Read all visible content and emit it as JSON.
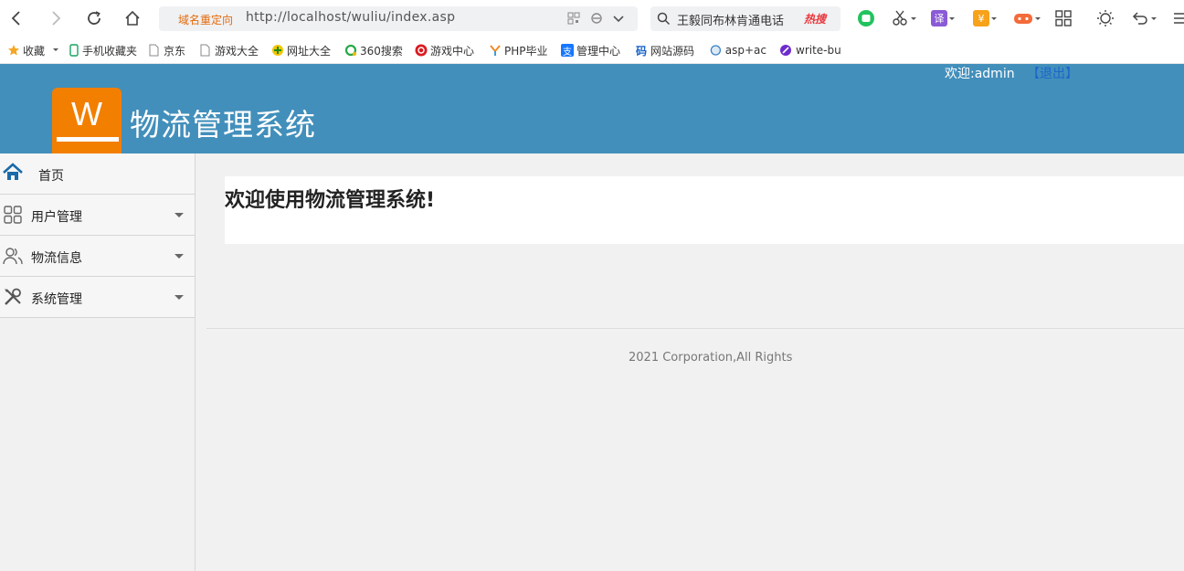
{
  "browser": {
    "address": {
      "redirect_label": "域名重定向",
      "url": "http://localhost/wuliu/index.asp"
    },
    "search": {
      "text": "王毅同布林肯通电话",
      "hot_label": "热搜"
    },
    "tool_labels": {
      "translate": "译",
      "coupon": "¥"
    },
    "bookmarks": [
      {
        "label": "收藏",
        "icon": "star-icon"
      },
      {
        "label": "手机收藏夹",
        "icon": "phone-icon"
      },
      {
        "label": "京东",
        "icon": "page-icon"
      },
      {
        "label": "游戏大全",
        "icon": "page-icon"
      },
      {
        "label": "网址大全",
        "icon": "globe-icon"
      },
      {
        "label": "360搜索",
        "icon": "search360-icon"
      },
      {
        "label": "游戏中心",
        "icon": "game-icon"
      },
      {
        "label": "PHP毕业",
        "icon": "php-icon"
      },
      {
        "label": "管理中心",
        "icon": "admin-icon"
      },
      {
        "label": "网站源码",
        "icon": "code-icon"
      },
      {
        "label": "asp+ac",
        "icon": "asp-icon"
      },
      {
        "label": "write-bu",
        "icon": "write-icon"
      }
    ],
    "bookmark_glyphs": {
      "admin": "支",
      "code": "码"
    }
  },
  "header": {
    "logo_letter": "W",
    "title": "物流管理系统",
    "welcome_label": "欢迎:",
    "username": "admin",
    "logout_label": "【退出】"
  },
  "sidebar": {
    "items": [
      {
        "label": "首页",
        "icon": "home-icon"
      },
      {
        "label": "用户管理",
        "icon": "grid-icon"
      },
      {
        "label": "物流信息",
        "icon": "users-icon"
      },
      {
        "label": "系统管理",
        "icon": "tools-icon"
      }
    ]
  },
  "main": {
    "welcome_heading": "欢迎使用物流管理系统!",
    "footer": "2021 Corporation,All Rights"
  },
  "colors": {
    "header_bg": "#428fbb",
    "logo_bg": "#f27f00",
    "logout_link": "#1b66c9",
    "redirect_label": "#e36b0c",
    "hot_label": "#e8373d"
  }
}
